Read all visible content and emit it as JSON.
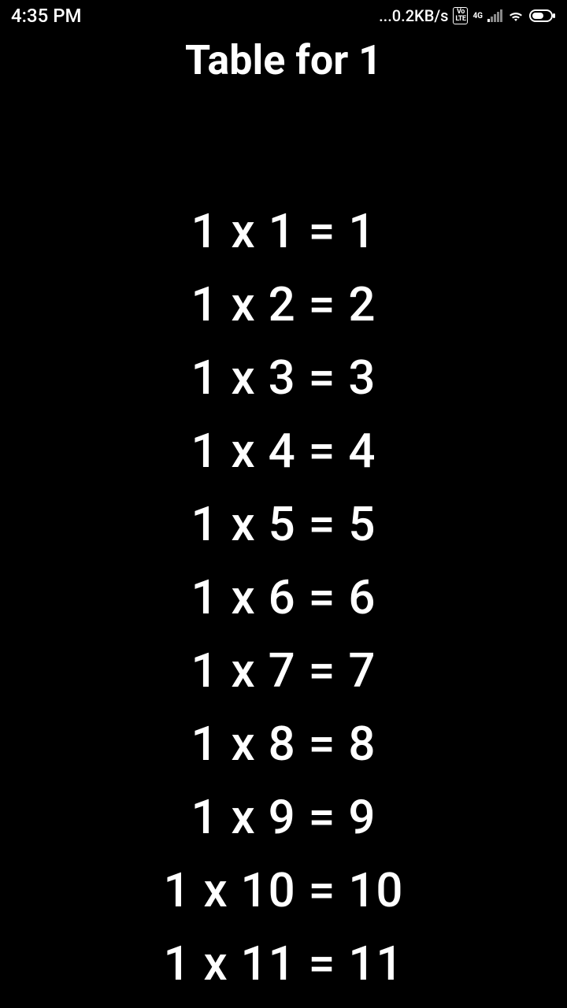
{
  "status_bar": {
    "time": "4:35 PM",
    "data_rate": "...0.2KB/s",
    "network_type": "4G"
  },
  "page_title": "Table for 1",
  "table_rows": [
    "1 x 1 = 1",
    "1 x 2 = 2",
    "1 x 3 = 3",
    "1 x 4 = 4",
    "1 x 5 = 5",
    "1 x 6 = 6",
    "1 x 7 = 7",
    "1 x 8 = 8",
    "1 x 9 = 9",
    "1 x 10 = 10",
    "1 x 11 = 11"
  ]
}
